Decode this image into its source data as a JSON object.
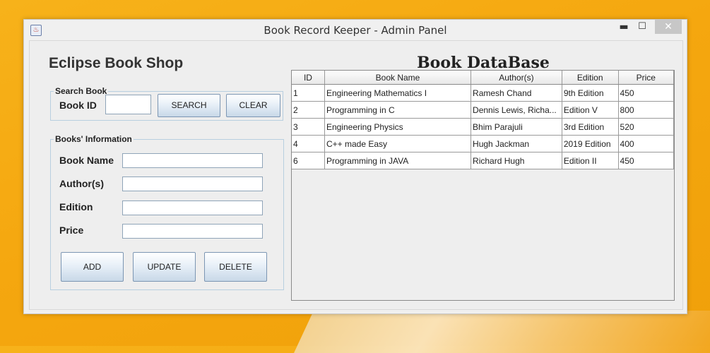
{
  "window": {
    "title": "Book Record Keeper - Admin Panel",
    "app_icon": "java-icon",
    "minimize_glyph": "▬",
    "maximize_glyph": "☐",
    "close_glyph": "✕"
  },
  "shop_title": "Eclipse Book Shop",
  "search": {
    "legend": "Search Book",
    "id_label": "Book ID",
    "id_value": "",
    "search_label": "SEARCH",
    "clear_label": "CLEAR"
  },
  "info": {
    "legend": "Books' Information",
    "fields": [
      {
        "label": "Book Name",
        "value": ""
      },
      {
        "label": "Author(s)",
        "value": ""
      },
      {
        "label": "Edition",
        "value": ""
      },
      {
        "label": "Price",
        "value": ""
      }
    ],
    "add_label": "ADD",
    "update_label": "UPDATE",
    "delete_label": "DELETE"
  },
  "database": {
    "title": "Book DataBase",
    "columns": [
      "ID",
      "Book Name",
      "Author(s)",
      "Edition",
      "Price"
    ],
    "rows": [
      [
        "1",
        "Engineering Mathematics I",
        "Ramesh Chand",
        "9th Edition",
        "450"
      ],
      [
        "2",
        "Programming in C",
        "Dennis Lewis, Richa...",
        "Edition V",
        "800"
      ],
      [
        "3",
        "Engineering Physics",
        "Bhim Parajuli",
        "3rd Edition",
        "520"
      ],
      [
        "4",
        "C++ made Easy",
        "Hugh Jackman",
        "2019 Edition",
        "400"
      ],
      [
        "6",
        "Programming in JAVA",
        "Richard Hugh",
        "Edition II",
        "450"
      ]
    ]
  }
}
